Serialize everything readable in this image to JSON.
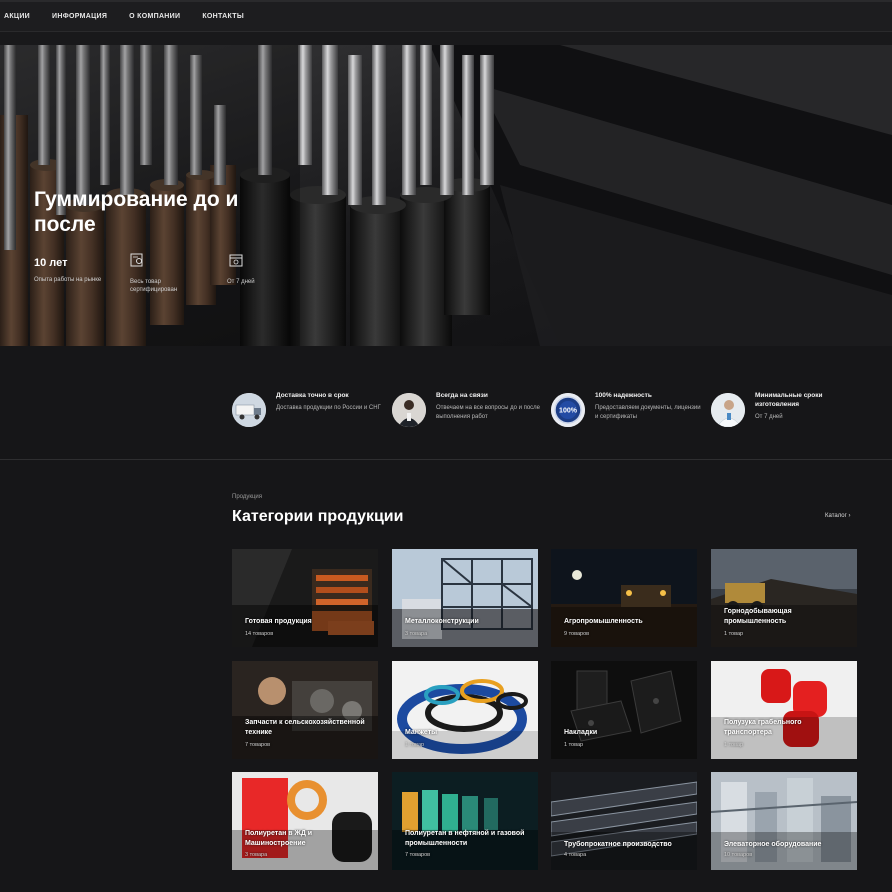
{
  "nav": {
    "items": [
      {
        "label": "АКЦИИ"
      },
      {
        "label": "ИНФОРМАЦИЯ"
      },
      {
        "label": "О КОМПАНИИ"
      },
      {
        "label": "КОНТАКТЫ"
      }
    ]
  },
  "hero": {
    "title": "Гуммирование до и после",
    "stats": {
      "years_value": "10 лет",
      "years_label": "Опыта работы на рынке",
      "certified_label_1": "Весь товар",
      "certified_label_2": "сертифицирован",
      "term_label": "От 7 дней"
    },
    "arrows": {
      "prev": "‹",
      "next": "›"
    }
  },
  "features": [
    {
      "icon": "truck-icon",
      "title": "Доставка точно в срок",
      "text": "Доставка продукции по России и СНГ"
    },
    {
      "icon": "support-person-icon",
      "title": "Всегда на связи",
      "text": "Отвечаем на все вопросы до и после выполнения работ"
    },
    {
      "icon": "badge-100-icon",
      "title": "100% надежность",
      "text": "Предоставляем документы, лицензии и сертификаты",
      "badge": "100%"
    },
    {
      "icon": "doctor-icon",
      "title": "Минимальные сроки изготовления",
      "text": "От 7 дней"
    }
  ],
  "categories": {
    "eyebrow": "Продукция",
    "heading": "Категории продукции",
    "catalog_link": "Каталог  ›",
    "cards": [
      {
        "name": "Готовая продукция",
        "count": "14 товаров"
      },
      {
        "name": "Металлоконструкции",
        "count": "3 товара"
      },
      {
        "name": "Агропромышленность",
        "count": "9 товаров"
      },
      {
        "name": "Горнодобывающая промышленность",
        "count": "1 товар"
      },
      {
        "name": "Запчасти к сельскохозяйственной технике",
        "count": "7 товаров"
      },
      {
        "name": "Манжеты",
        "count": "1 товар"
      },
      {
        "name": "Накладки",
        "count": "1 товар"
      },
      {
        "name": "Полузука грабельного транспортера",
        "count": "1 товар"
      },
      {
        "name": "Полиуретан в ЖД и Машиностроение",
        "count": "3 товара"
      },
      {
        "name": "Полиуретан в нефтяной и газовой промышленности",
        "count": "7 товаров"
      },
      {
        "name": "Трубопрокатное производство",
        "count": "4 товара"
      },
      {
        "name": "Элеваторное оборудование",
        "count": "10 товаров"
      }
    ]
  },
  "colors": {
    "accent": "#e9662c",
    "background": "#161618"
  }
}
